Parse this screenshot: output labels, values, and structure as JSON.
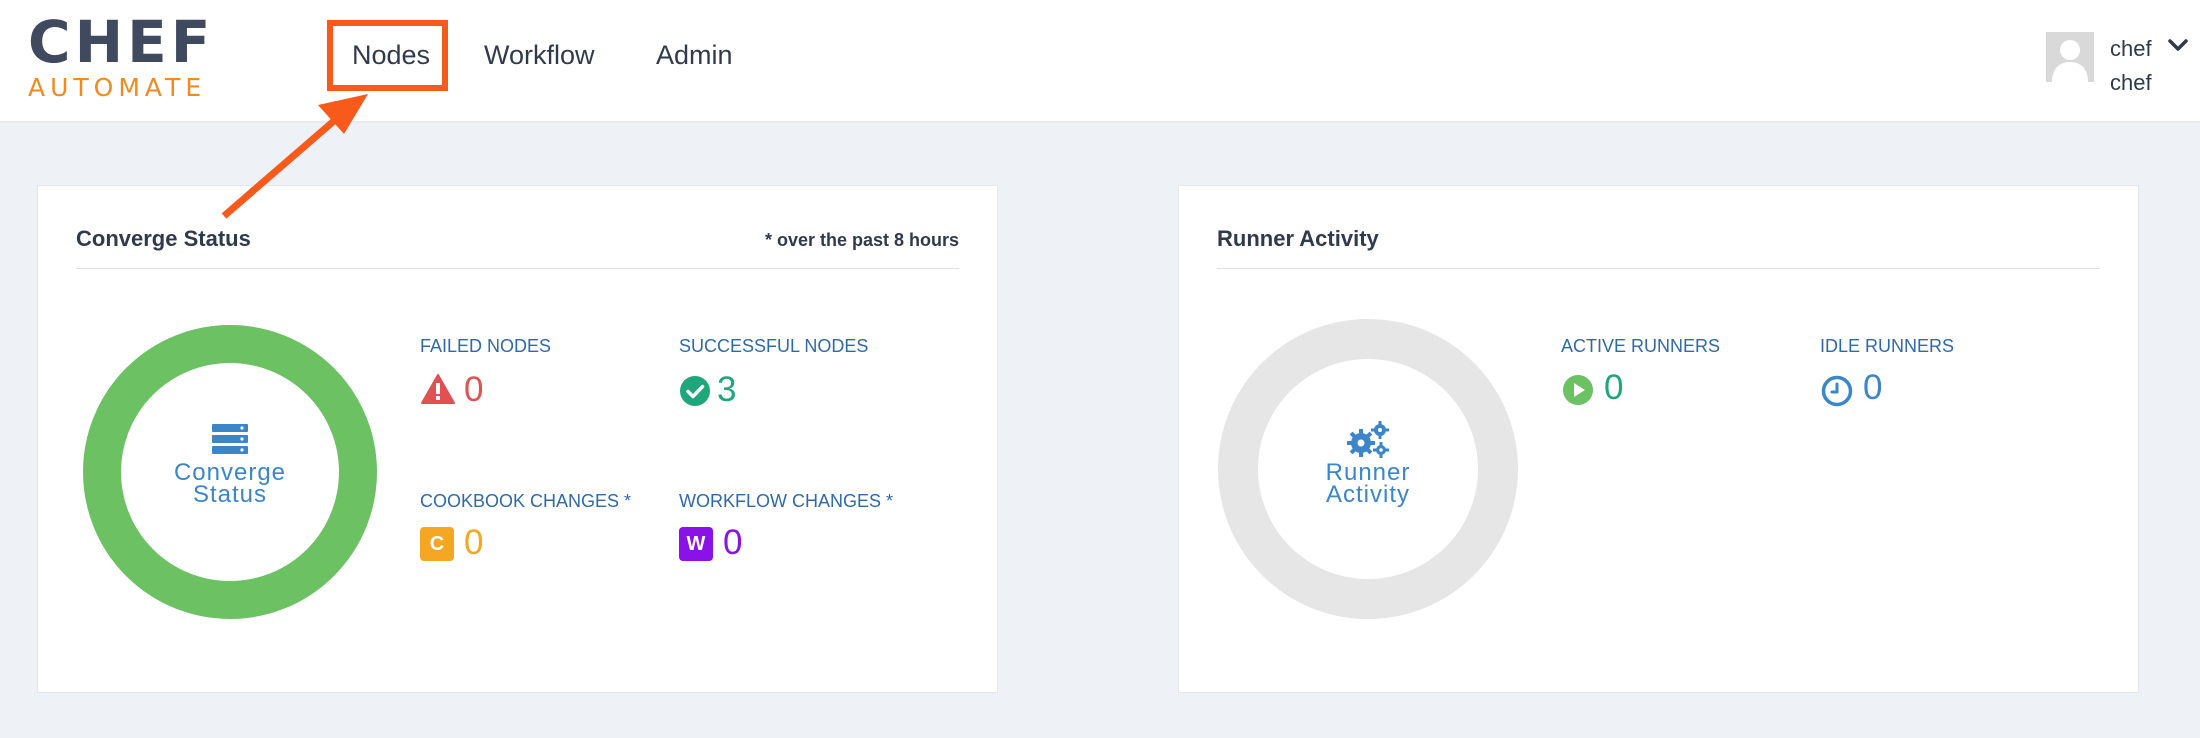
{
  "brand": {
    "line1": "CHEF",
    "line2": "AUTOMATE"
  },
  "nav": {
    "nodes": "Nodes",
    "workflow": "Workflow",
    "admin": "Admin"
  },
  "user": {
    "name": "chef",
    "subtitle": "chef"
  },
  "converge": {
    "title": "Converge Status",
    "note": "* over the past 8 hours",
    "center_line1": "Converge",
    "center_line2": "Status",
    "failed_label": "FAILED NODES",
    "failed_value": "0",
    "success_label": "SUCCESSFUL NODES",
    "success_value": "3",
    "cookbook_label": "COOKBOOK CHANGES *",
    "cookbook_badge": "C",
    "cookbook_value": "0",
    "workflow_label": "WORKFLOW CHANGES *",
    "workflow_badge": "W",
    "workflow_value": "0"
  },
  "runner": {
    "title": "Runner Activity",
    "center_line1": "Runner",
    "center_line2": "Activity",
    "active_label": "ACTIVE RUNNERS",
    "active_value": "0",
    "idle_label": "IDLE RUNNERS",
    "idle_value": "0"
  },
  "colors": {
    "accent_orange": "#f75a1a",
    "success_green": "#6cc163",
    "failed_red": "#e05252",
    "cookbook_orange": "#f5a623",
    "workflow_purple": "#8a12e6",
    "link_blue": "#3a86c8",
    "idle_gray": "#e6e6e6"
  },
  "icons": {
    "failed": "warning-triangle-icon",
    "success": "check-circle-icon",
    "active": "play-circle-icon",
    "idle": "clock-icon",
    "converge": "server-stack-icon",
    "runner": "gears-icon"
  }
}
